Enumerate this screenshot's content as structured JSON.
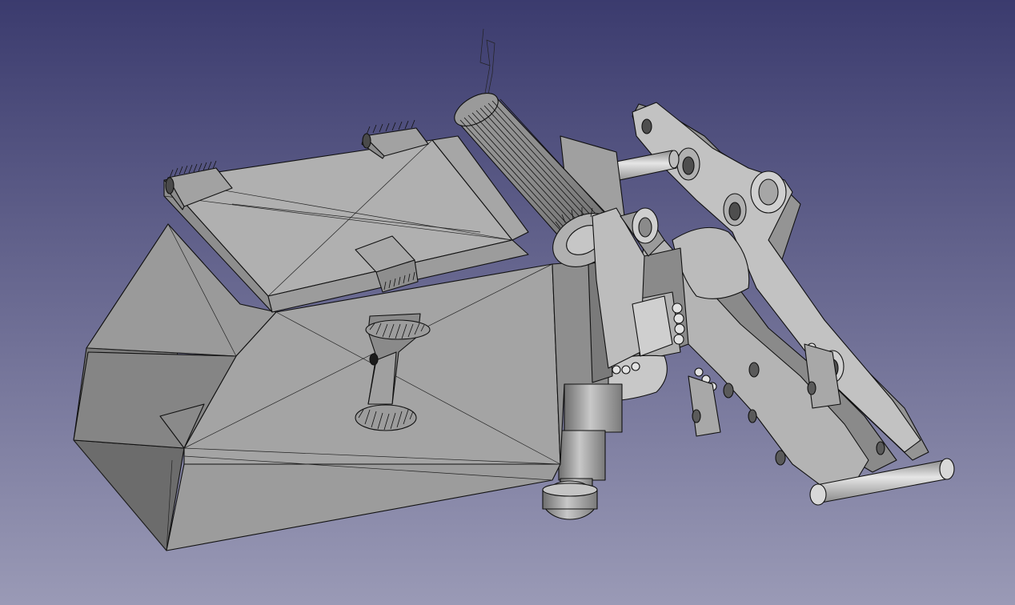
{
  "view": {
    "kind": "3D CAD viewport",
    "background": {
      "top": "#3b3b6e",
      "bottom": "#9a9ab6"
    },
    "shading": {
      "face_light": "#a3a3a3",
      "face_mid": "#8e8e8e",
      "face_dark": "#7a7a7a",
      "face_shadow": "#6c6c6c",
      "edge": "#111111",
      "highlight": "#dedede"
    }
  },
  "scene": {
    "objects": [
      "housing-box",
      "housing-lid",
      "cylinder-roller",
      "linkage-arm-upper",
      "linkage-arm-lower",
      "cross-pin-upper",
      "cross-pin-lower",
      "mounting-post",
      "latch-handle",
      "hinge-tab-left",
      "hinge-tab-right",
      "antenna-wire"
    ]
  }
}
